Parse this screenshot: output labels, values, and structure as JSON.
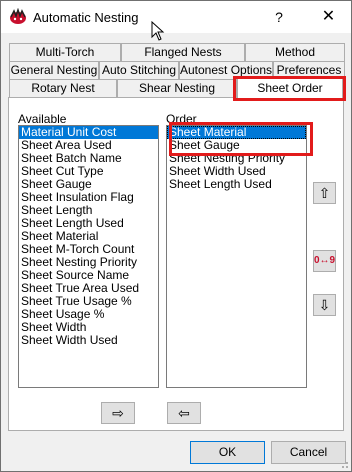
{
  "window": {
    "title": "Automatic Nesting",
    "help_label": "?",
    "close_label": "✕"
  },
  "tabs": {
    "row1": [
      "Multi-Torch",
      "Flanged Nests",
      "Method"
    ],
    "row2": [
      "General Nesting",
      "Auto Stitching",
      "Autonest Options",
      "Preferences"
    ],
    "row3": [
      "Rotary Nest",
      "Shear Nesting",
      "Sheet Order"
    ],
    "active": "Sheet Order"
  },
  "available": {
    "label": "Available",
    "items": [
      "Material Unit Cost",
      "Sheet Area Used",
      "Sheet Batch Name",
      "Sheet Cut Type",
      "Sheet Gauge",
      "Sheet Insulation Flag",
      "Sheet Length",
      "Sheet Length Used",
      "Sheet Material",
      "Sheet M-Torch Count",
      "Sheet Nesting Priority",
      "Sheet Source Name",
      "Sheet True Area Used",
      "Sheet True Usage %",
      "Sheet Usage %",
      "Sheet Width",
      "Sheet Width Used"
    ],
    "selected_index": 0
  },
  "order": {
    "label": "Order",
    "items": [
      "Sheet Material",
      "Sheet Gauge",
      "Sheet Nesting Priority",
      "Sheet Width Used",
      "Sheet Length Used"
    ],
    "selected_index": 0
  },
  "buttons": {
    "move_up": "⇧",
    "swap": "0↔9",
    "move_down": "⇩",
    "add": "⇨",
    "remove": "⇦",
    "ok": "OK",
    "cancel": "Cancel"
  },
  "colors": {
    "highlight": "#e21b1b",
    "selection": "#0078d7"
  }
}
